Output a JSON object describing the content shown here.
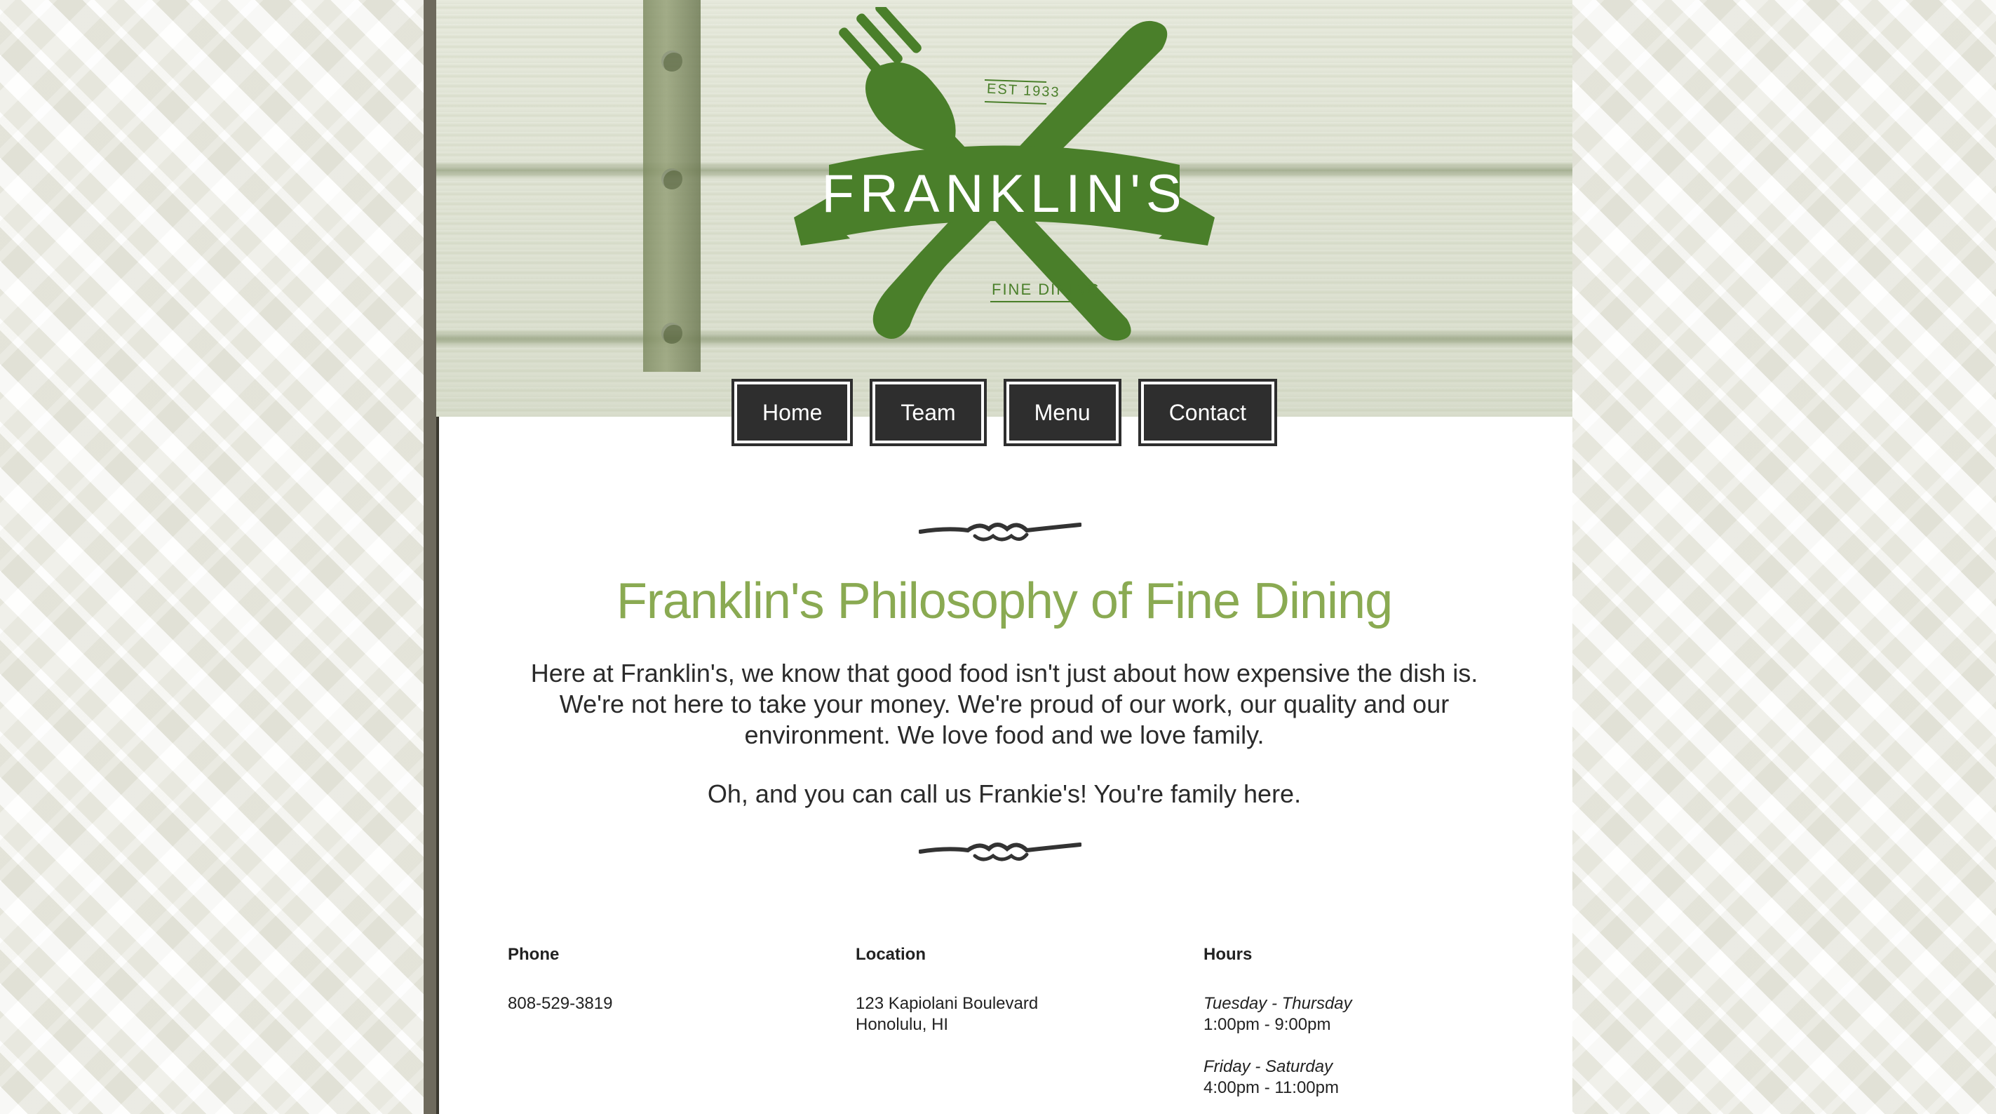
{
  "brand": {
    "name": "FRANKLIN'S",
    "established": "EST 1933",
    "tagline": "FINE DINING",
    "accent_color": "#8aaa52",
    "logo_color": "#4a7f2a"
  },
  "nav": {
    "items": [
      {
        "label": "Home"
      },
      {
        "label": "Team"
      },
      {
        "label": "Menu"
      },
      {
        "label": "Contact"
      }
    ]
  },
  "main": {
    "title": "Franklin's Philosophy of Fine Dining",
    "paragraph_1": "Here at Franklin's, we know that good food isn't just about how expensive the dish is. We're not here to take your money. We're proud of our work, our quality and our environment. We love food and we love family.",
    "paragraph_2": "Oh, and you can call us Frankie's! You're family here."
  },
  "info": {
    "phone": {
      "heading": "Phone",
      "value": "808-529-3819"
    },
    "location": {
      "heading": "Location",
      "line_1": "123 Kapiolani Boulevard",
      "line_2": "Honolulu, HI"
    },
    "hours": {
      "heading": "Hours",
      "entries": [
        {
          "days": "Tuesday - Thursday",
          "time": "1:00pm - 9:00pm"
        },
        {
          "days": "Friday - Saturday",
          "time": "4:00pm - 11:00pm"
        }
      ]
    }
  },
  "icons": [
    "fork-icon",
    "knife-icon",
    "banner-ribbon",
    "flourish-divider"
  ]
}
